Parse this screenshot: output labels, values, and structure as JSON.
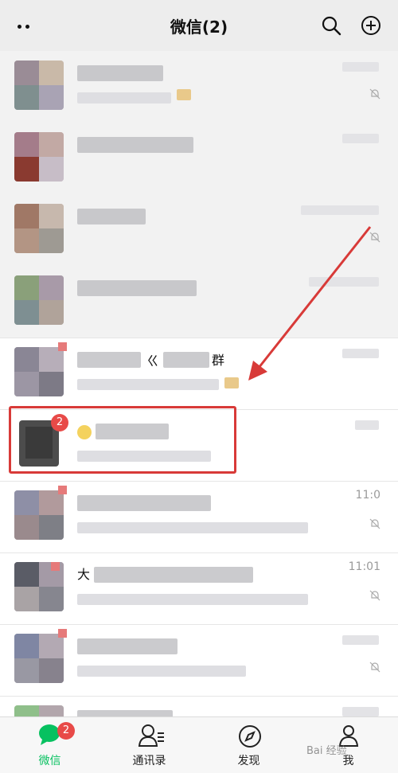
{
  "header": {
    "title": "微信(2)"
  },
  "chats": [
    {
      "id": 1,
      "time_text": ""
    },
    {
      "id": 2,
      "time_text": ""
    },
    {
      "id": 3,
      "time_text": ""
    },
    {
      "id": 4,
      "time_text": ""
    },
    {
      "id": 5,
      "overlay_fragment_a": "ㄍ",
      "overlay_fragment_b": "群",
      "time_text": ""
    },
    {
      "id": 6,
      "badge": "2",
      "time_text": ""
    },
    {
      "id": 7,
      "time_text": "11:0"
    },
    {
      "id": 8,
      "overlay_fragment": "大",
      "time_text": "11:01"
    },
    {
      "id": 9,
      "time_text": ""
    },
    {
      "id": 10,
      "time_text": ""
    }
  ],
  "tabbar": {
    "tabs": [
      {
        "label": "微信",
        "badge": "2",
        "active": true
      },
      {
        "label": "通讯录",
        "active": false
      },
      {
        "label": "发现",
        "active": false
      },
      {
        "label": "我",
        "active": false
      }
    ]
  },
  "watermark": "Bai 经验",
  "colors": {
    "accent_green": "#07c160",
    "badge_red": "#e84a48",
    "annotation_red": "#d83a38"
  }
}
